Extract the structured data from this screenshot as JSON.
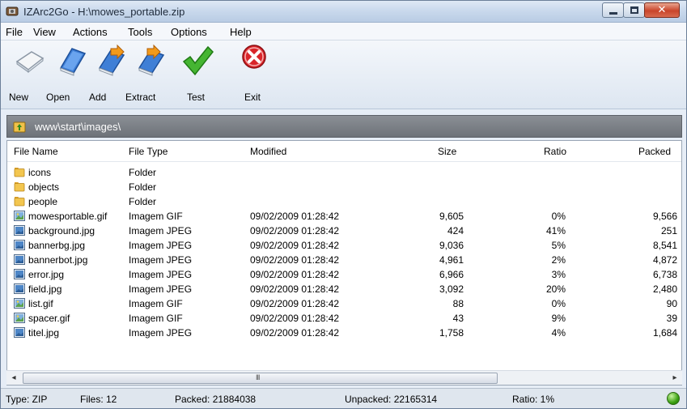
{
  "window": {
    "title": "IZArc2Go - H:\\mowes_portable.zip"
  },
  "menu": [
    "File",
    "View",
    "Actions",
    "Tools",
    "Options",
    "Help"
  ],
  "toolbar": {
    "new_label": "New",
    "open_label": "Open",
    "add_label": "Add",
    "extract_label": "Extract",
    "test_label": "Test",
    "exit_label": "Exit"
  },
  "path": "www\\start\\images\\",
  "columns": {
    "name": "File Name",
    "type": "File Type",
    "modified": "Modified",
    "size": "Size",
    "ratio": "Ratio",
    "packed": "Packed"
  },
  "files": [
    {
      "name": "icons",
      "type": "Folder",
      "modified": "",
      "size": "",
      "ratio": "",
      "packed": "",
      "icon": "folder-icon"
    },
    {
      "name": "objects",
      "type": "Folder",
      "modified": "",
      "size": "",
      "ratio": "",
      "packed": "",
      "icon": "folder-icon"
    },
    {
      "name": "people",
      "type": "Folder",
      "modified": "",
      "size": "",
      "ratio": "",
      "packed": "",
      "icon": "folder-icon"
    },
    {
      "name": "mowesportable.gif",
      "type": "Imagem GIF",
      "modified": "09/02/2009 01:28:42",
      "size": "9,605",
      "ratio": "0%",
      "packed": "9,566",
      "icon": "gif-image-icon"
    },
    {
      "name": "background.jpg",
      "type": "Imagem JPEG",
      "modified": "09/02/2009 01:28:42",
      "size": "424",
      "ratio": "41%",
      "packed": "251",
      "icon": "jpeg-image-icon"
    },
    {
      "name": "bannerbg.jpg",
      "type": "Imagem JPEG",
      "modified": "09/02/2009 01:28:42",
      "size": "9,036",
      "ratio": "5%",
      "packed": "8,541",
      "icon": "jpeg-image-icon"
    },
    {
      "name": "bannerbot.jpg",
      "type": "Imagem JPEG",
      "modified": "09/02/2009 01:28:42",
      "size": "4,961",
      "ratio": "2%",
      "packed": "4,872",
      "icon": "jpeg-image-icon"
    },
    {
      "name": "error.jpg",
      "type": "Imagem JPEG",
      "modified": "09/02/2009 01:28:42",
      "size": "6,966",
      "ratio": "3%",
      "packed": "6,738",
      "icon": "jpeg-image-icon"
    },
    {
      "name": "field.jpg",
      "type": "Imagem JPEG",
      "modified": "09/02/2009 01:28:42",
      "size": "3,092",
      "ratio": "20%",
      "packed": "2,480",
      "icon": "jpeg-image-icon"
    },
    {
      "name": "list.gif",
      "type": "Imagem GIF",
      "modified": "09/02/2009 01:28:42",
      "size": "88",
      "ratio": "0%",
      "packed": "90",
      "icon": "gif-image-icon"
    },
    {
      "name": "spacer.gif",
      "type": "Imagem GIF",
      "modified": "09/02/2009 01:28:42",
      "size": "43",
      "ratio": "9%",
      "packed": "39",
      "icon": "gif-image-icon"
    },
    {
      "name": "titel.jpg",
      "type": "Imagem JPEG",
      "modified": "09/02/2009 01:28:42",
      "size": "1,758",
      "ratio": "4%",
      "packed": "1,684",
      "icon": "jpeg-image-icon"
    }
  ],
  "scrollbar": {
    "grip": "III"
  },
  "status": {
    "type": "Type: ZIP",
    "files": "Files: 12",
    "packed": "Packed: 21884038",
    "unpacked": "Unpacked: 22165314",
    "ratio": "Ratio: 1%"
  },
  "colors": {
    "path_bar": "#7a7e84",
    "status_led": "#3aa012",
    "folder": "#e8b43a",
    "exit": "#d9252a",
    "test": "#3aa52a"
  }
}
